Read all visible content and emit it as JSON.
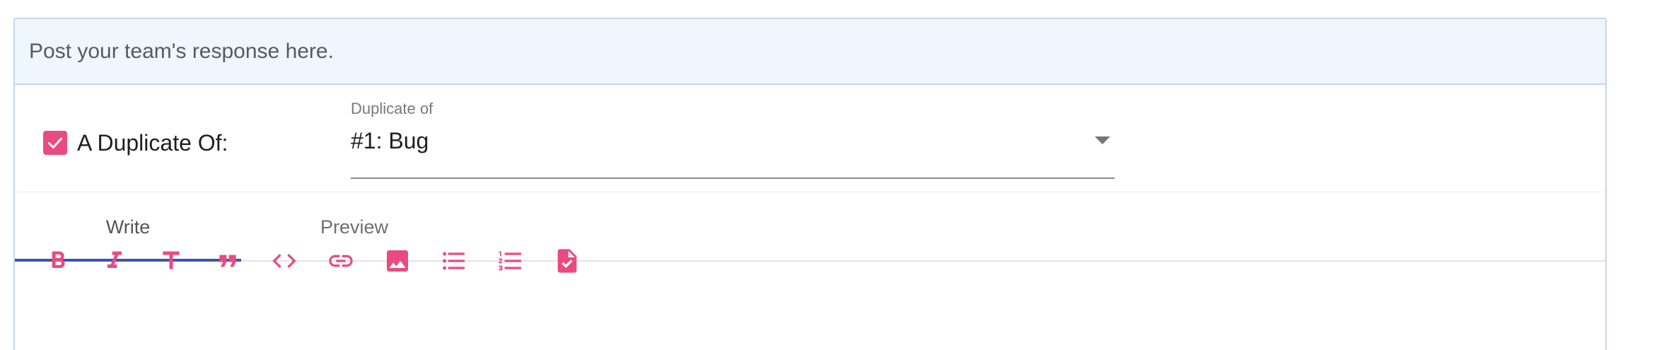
{
  "header": {
    "text": "Post your team's response here."
  },
  "duplicate": {
    "checked": true,
    "label": "A Duplicate Of:",
    "select": {
      "floating_label": "Duplicate of",
      "value": "#1: Bug"
    }
  },
  "tabs": [
    {
      "label": "Write",
      "active": true
    },
    {
      "label": "Preview",
      "active": false
    }
  ],
  "toolbar": {
    "icons": [
      "bold-icon",
      "italic-icon",
      "heading-icon",
      "quote-icon",
      "code-icon",
      "link-icon",
      "image-icon",
      "bulleted-list-icon",
      "numbered-list-icon",
      "task-list-icon"
    ]
  },
  "colors": {
    "accent": "#e94b7f",
    "tab_ink": "#3f51b5",
    "header_bg": "#f0f6fd",
    "border": "#c5d7ec"
  }
}
